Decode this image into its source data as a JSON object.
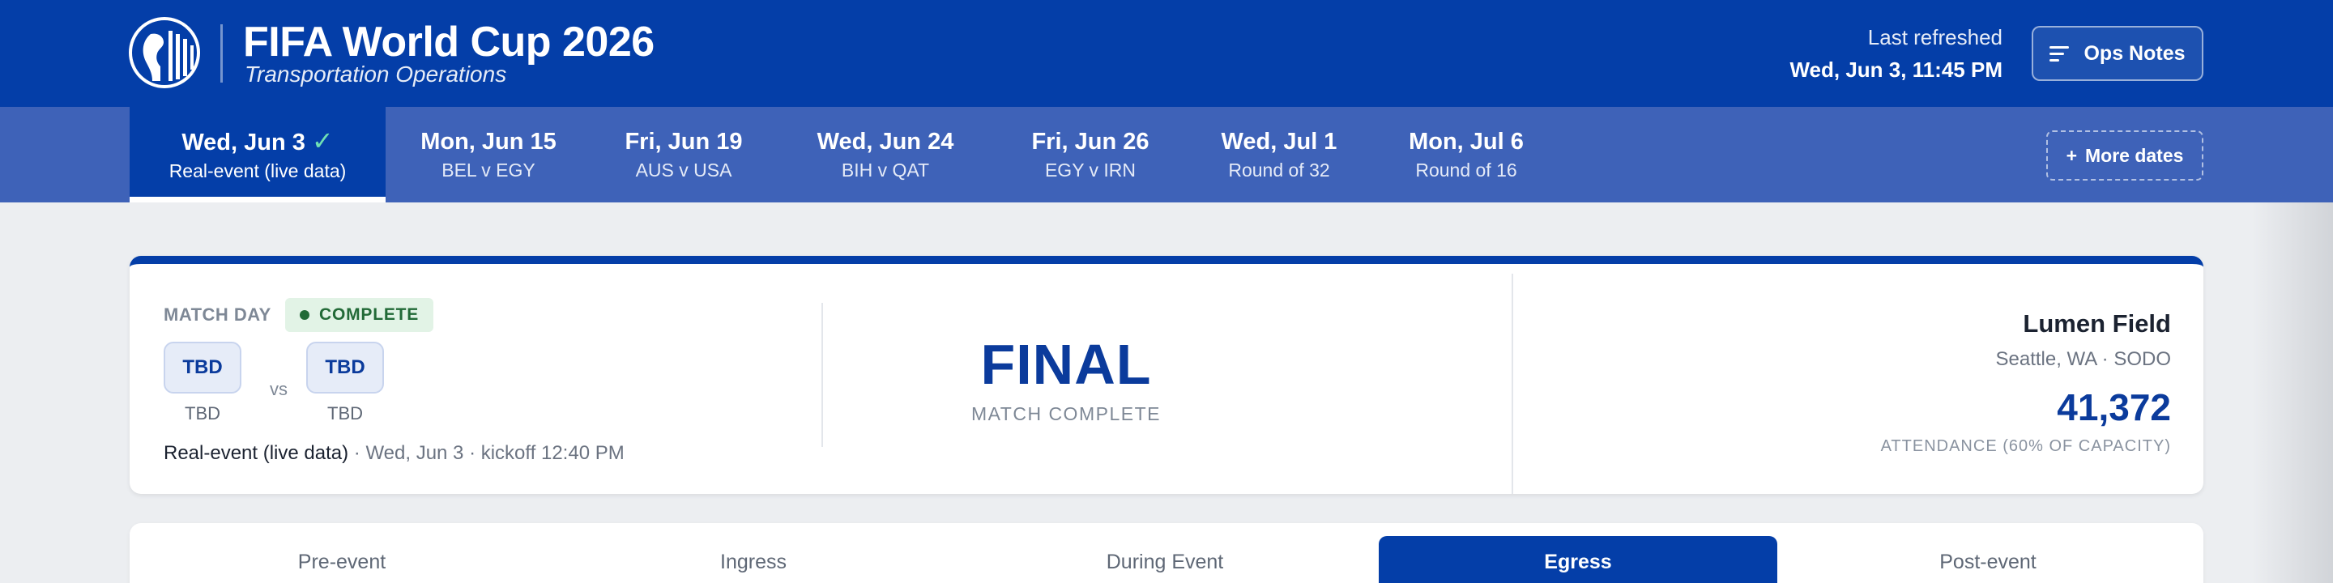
{
  "header": {
    "title": "FIFA World Cup 2026",
    "subtitle": "Transportation Operations",
    "refresh_label": "Last refreshed",
    "refresh_time": "Wed, Jun 3, 11:45 PM",
    "ops_notes_label": "Ops Notes"
  },
  "date_tabs": [
    {
      "date": "Wed, Jun 3",
      "sub": "Real-event (live data)",
      "active": true
    },
    {
      "date": "Mon, Jun 15",
      "sub": "BEL v EGY"
    },
    {
      "date": "Fri, Jun 19",
      "sub": "AUS v USA"
    },
    {
      "date": "Wed, Jun 24",
      "sub": "BIH v QAT"
    },
    {
      "date": "Fri, Jun 26",
      "sub": "EGY v IRN"
    },
    {
      "date": "Wed, Jul 1",
      "sub": "Round of 32"
    },
    {
      "date": "Mon, Jul 6",
      "sub": "Round of 16"
    }
  ],
  "more_dates_label": "More dates",
  "match": {
    "day_label": "MATCH DAY",
    "status": "COMPLETE",
    "home": {
      "code": "TBD",
      "name": "TBD"
    },
    "vs": "vs",
    "away": {
      "code": "TBD",
      "name": "TBD"
    },
    "meta_strong": "Real-event (live data)",
    "meta_rest": " · Wed, Jun 3 · kickoff 12:40 PM",
    "result": "FINAL",
    "result_sub": "MATCH COMPLETE",
    "venue": "Lumen Field",
    "venue_location": "Seattle, WA · SODO",
    "attendance": "41,372",
    "attendance_label": "ATTENDANCE (60% OF CAPACITY)"
  },
  "phases": [
    {
      "label": "Pre-event"
    },
    {
      "label": "Ingress"
    },
    {
      "label": "During Event"
    },
    {
      "label": "Egress",
      "active": true
    },
    {
      "label": "Post-event"
    }
  ],
  "colors": {
    "primary": "#043ea8",
    "date_bar": "#3e62b8",
    "accent_check": "#6fe0b4",
    "status_bg": "#e2f3e6",
    "status_fg": "#226a37"
  },
  "icons": {
    "logo": "seattle-seal-logo",
    "ops_notes": "menu-lines-icon",
    "check": "check-icon",
    "more": "plus-icon"
  }
}
